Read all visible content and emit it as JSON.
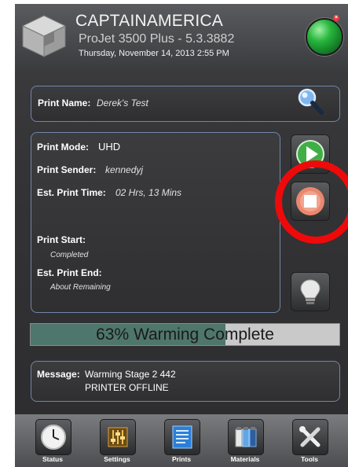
{
  "header": {
    "printer_name": "CAPTAINAMERICA",
    "printer_model": "ProJet 3500 Plus - 5.3.3882",
    "datetime": "Thursday, November 14, 2013 2:55 PM",
    "status_color": "#27b53c"
  },
  "job": {
    "print_name_label": "Print Name:",
    "print_name": "Derek's Test",
    "print_mode_label": "Print Mode:",
    "print_mode": "UHD",
    "print_sender_label": "Print Sender:",
    "print_sender": "kennedyj",
    "est_time_label": "Est. Print Time:",
    "est_time": "02 Hrs, 13 Mins",
    "print_start_label": "Print Start:",
    "print_start": "Completed",
    "est_end_label": "Est. Print End:",
    "est_end": "About  Remaining"
  },
  "progress": {
    "percent": 63,
    "text": "63% Warming Complete",
    "fill_color": "#4f766c"
  },
  "message": {
    "label": "Message:",
    "line1": "Warming Stage 2 442",
    "line2": "PRINTER OFFLINE"
  },
  "controls": {
    "play_icon": "play-icon",
    "stop_icon": "stop-icon",
    "light_icon": "lightbulb-icon",
    "search_icon": "magnifier-icon"
  },
  "dock": {
    "items": [
      {
        "label": "Status",
        "icon": "clock-icon"
      },
      {
        "label": "Settings",
        "icon": "sliders-icon"
      },
      {
        "label": "Prints",
        "icon": "document-icon"
      },
      {
        "label": "Materials",
        "icon": "bottles-icon"
      },
      {
        "label": "Tools",
        "icon": "tools-icon"
      }
    ]
  },
  "annotation_color": "#ee0a0a"
}
